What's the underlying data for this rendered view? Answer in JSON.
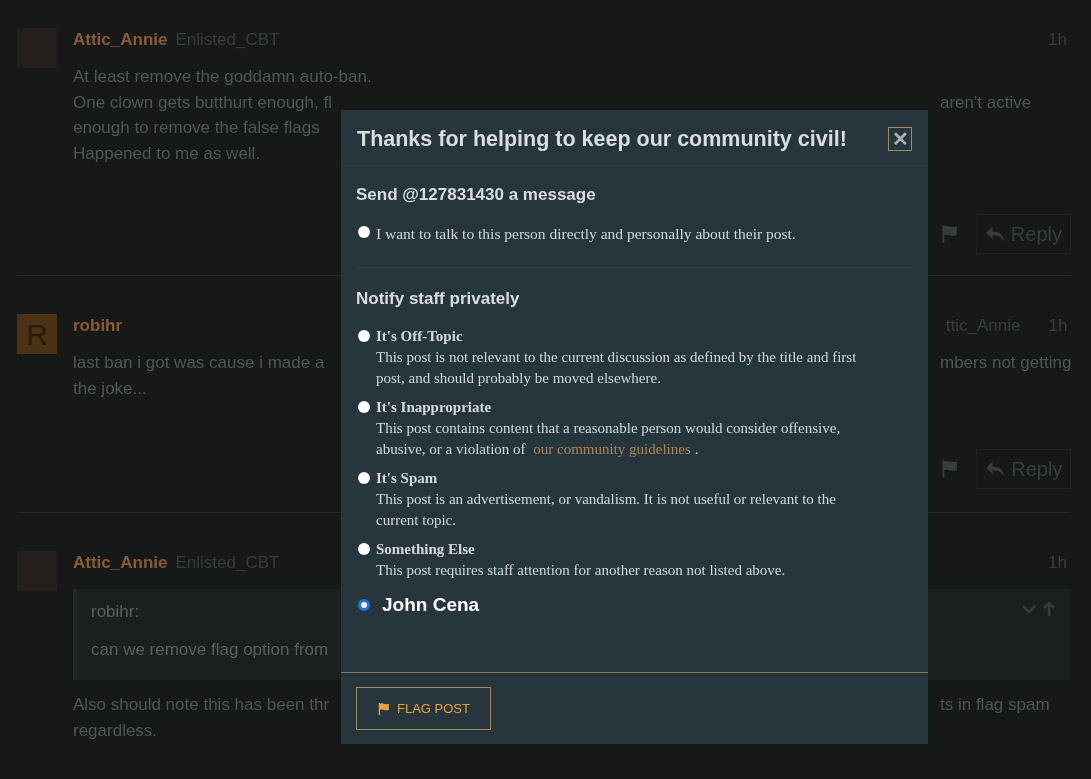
{
  "posts": [
    {
      "avatar": {
        "kind": "photo"
      },
      "username": "Attic_Annie",
      "user_title": "Enlisted_CBT",
      "time": "1h",
      "body": [
        {
          "left": "At least remove the goddamn auto-ban."
        },
        {
          "left": "One clown gets butthurt enough, fl",
          "right": "aren't active"
        },
        {
          "left": "enough to remove the false flags"
        },
        {
          "left": "Happened to me as well."
        }
      ],
      "actions": {
        "reply": "Reply"
      }
    },
    {
      "avatar": {
        "kind": "letter",
        "letter": "R"
      },
      "username": "robihr",
      "reply_to": "ttic_Annie",
      "time": "1h",
      "body": [
        {
          "left": "last ban i got was cause i made a",
          "right": "mbers not getting"
        },
        {
          "left": "the joke..."
        }
      ],
      "actions": {
        "reply": "Reply"
      }
    },
    {
      "avatar": {
        "kind": "photo"
      },
      "username": "Attic_Annie",
      "user_title": "Enlisted_CBT",
      "time": "1h",
      "quote": {
        "author": "robihr:",
        "text": "can we remove flag option from"
      },
      "body": [
        {
          "left": "Also should note this has been thr",
          "right": "ts in flag spam"
        },
        {
          "left": "regardless."
        }
      ]
    }
  ],
  "modal": {
    "title": "Thanks for helping to keep our community civil!",
    "close": "✕",
    "sections": [
      {
        "heading": "Send @127831430 a message",
        "options": [
          {
            "kind": "simple",
            "label": "I want to talk to this person directly and personally about their post.",
            "selected": false
          }
        ]
      },
      {
        "heading": "Notify staff privately",
        "options": [
          {
            "kind": "described",
            "title": "It's Off-Topic",
            "description": "This post is not relevant to the current discussion as defined by the title and first post, and should probably be moved elsewhere.",
            "selected": false
          },
          {
            "kind": "described",
            "title": "It's Inappropriate",
            "description": "This post contains content that a reasonable person would consider offensive, abusive, or a violation of",
            "link": "our community guidelines",
            "after": ".",
            "selected": false
          },
          {
            "kind": "described",
            "title": "It's Spam",
            "description": "This post is an advertisement, or vandalism. It is not useful or relevant to the current topic.",
            "selected": false
          },
          {
            "kind": "described",
            "title": "Something Else",
            "description": "This post requires staff attention for another reason not listed above.",
            "selected": false
          },
          {
            "kind": "custom",
            "label": "John Cena",
            "selected": true
          }
        ]
      }
    ],
    "button": "FLAG POST"
  }
}
